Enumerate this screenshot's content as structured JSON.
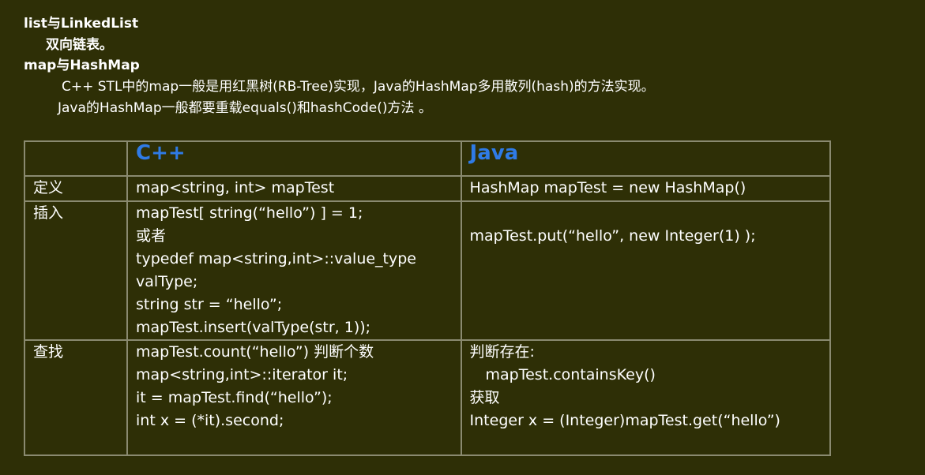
{
  "intro": {
    "line1": "list与LinkedList",
    "line2": "双向链表。",
    "line3": "map与HashMap",
    "line4": "C++ STL中的map一般是用红黑树(RB-Tree)实现，Java的HashMap多用散列(hash)的方法实现。",
    "line5": "Java的HashMap一般都要重载equals()和hashCode()方法 。"
  },
  "table": {
    "headers": [
      "",
      "C++",
      "Java"
    ],
    "rows": [
      {
        "label": "定义",
        "cpp": [
          "map<string, int> mapTest"
        ],
        "java": [
          "HashMap mapTest = new HashMap()"
        ]
      },
      {
        "label": "插入",
        "cpp": [
          "mapTest[ string(“hello”) ] = 1;",
          "或者",
          "typedef map<string,int>::value_type",
          "valType;",
          "string str = “hello”;",
          "mapTest.insert(valType(str, 1));"
        ],
        "java": [
          "mapTest.put(“hello”, new Integer(1) );"
        ]
      },
      {
        "label": "查找",
        "cpp": [
          "mapTest.count(“hello”) 判断个数",
          "map<string,int>::iterator it;",
          "it = mapTest.find(“hello”);",
          "int x = (*it).second;"
        ],
        "java": [
          "判断存在:",
          "mapTest.containsKey()",
          "获取",
          "Integer x = (Integer)mapTest.get(“hello”)"
        ]
      }
    ]
  },
  "colors": {
    "background": "#2e2f06",
    "text": "#ffffff",
    "header_accent": "#2f7be6",
    "border": "#8a8a70"
  }
}
